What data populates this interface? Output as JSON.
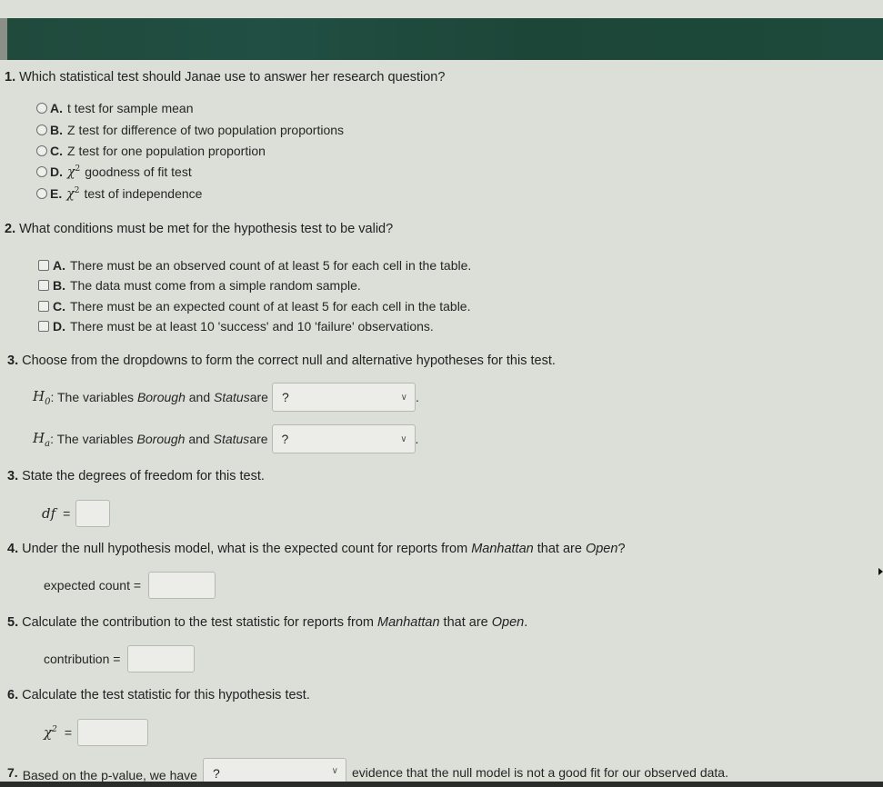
{
  "q1": {
    "number": "1.",
    "text": "Which statistical test should Janae use to answer her research question?",
    "options": [
      {
        "letter": "A.",
        "text": "t test for sample mean"
      },
      {
        "letter": "B.",
        "text": "Z test for difference of two population proportions"
      },
      {
        "letter": "C.",
        "text": "Z test for one population proportion"
      },
      {
        "letter": "D.",
        "symbol": "χ",
        "sup": "2",
        "text": "goodness of fit test"
      },
      {
        "letter": "E.",
        "symbol": "χ",
        "sup": "2",
        "text": "test of independence"
      }
    ]
  },
  "q2": {
    "number": "2.",
    "text": "What conditions must be met for the hypothesis test to be valid?",
    "options": [
      {
        "letter": "A.",
        "text": "There must be an observed count of at least 5 for each cell in the table."
      },
      {
        "letter": "B.",
        "text": "The data must come from a simple random sample."
      },
      {
        "letter": "C.",
        "text": "There must be an expected count of at least 5 for each cell in the table."
      },
      {
        "letter": "D.",
        "text": "There must be at least 10 'success' and 10 'failure' observations."
      }
    ]
  },
  "q3a": {
    "number": "3.",
    "text": "Choose from the dropdowns to form the correct null and alternative hypotheses for this test.",
    "h0": {
      "symbol": "H",
      "sub": "0",
      "prefix": ": The variables ",
      "var1": "Borough",
      "mid": " and ",
      "var2": "Status",
      "suffix": " are",
      "select_value": "?",
      "end": "."
    },
    "ha": {
      "symbol": "H",
      "sub": "a",
      "prefix": ": The variables ",
      "var1": "Borough",
      "mid": " and ",
      "var2": "Status",
      "suffix": " are",
      "select_value": "?",
      "end": "."
    }
  },
  "q3b": {
    "number": "3.",
    "text": "State the degrees of freedom for this test.",
    "label": "df",
    "equals": "=",
    "value": ""
  },
  "q4": {
    "number": "4.",
    "text_before": "Under the null hypothesis model, what is the expected count for reports from ",
    "italic1": "Manhattan",
    "text_mid": " that are ",
    "italic2": "Open",
    "text_end": "?",
    "label": "expected count =",
    "value": ""
  },
  "q5": {
    "number": "5.",
    "text_before": "Calculate the contribution to the test statistic for reports from ",
    "italic1": "Manhattan",
    "text_mid": " that are ",
    "italic2": "Open",
    "text_end": ".",
    "label": "contribution =",
    "value": ""
  },
  "q6": {
    "number": "6.",
    "text": "Calculate the test statistic for this hypothesis test.",
    "symbol": "χ",
    "sup": "2",
    "equals": "=",
    "value": ""
  },
  "q7": {
    "number": "7.",
    "text_before": "Based on the p-value, we have",
    "select_value": "?",
    "text_after": "evidence that the null model is not a good fit for our observed data."
  }
}
